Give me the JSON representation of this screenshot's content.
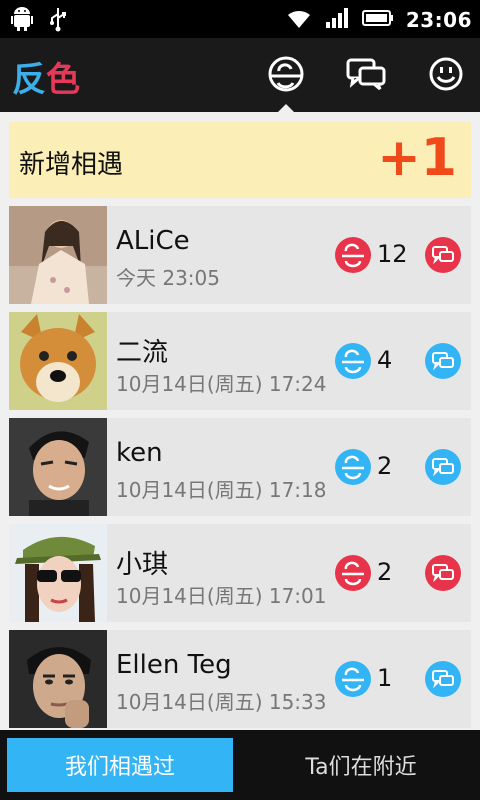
{
  "status_bar": {
    "time": "23:06",
    "icons": [
      "android-debug-icon",
      "usb-icon",
      "wifi-icon",
      "signal-icon",
      "battery-icon"
    ]
  },
  "header": {
    "logo_part1": "反",
    "logo_part2": "色",
    "icons": [
      "meet-icon",
      "chat-icon",
      "smiley-icon"
    ],
    "active_icon": "meet-icon"
  },
  "banner": {
    "text": "新增相遇",
    "count": "+1"
  },
  "contacts": [
    {
      "name": "ALiCe",
      "time": "今天 23:05",
      "meet_count": "12",
      "color": "#e8344a"
    },
    {
      "name": "二流",
      "time": "10月14日(周五) 17:24",
      "meet_count": "4",
      "color": "#33b5f5"
    },
    {
      "name": "ken",
      "time": "10月14日(周五) 17:18",
      "meet_count": "2",
      "color": "#33b5f5"
    },
    {
      "name": "小琪",
      "time": "10月14日(周五) 17:01",
      "meet_count": "2",
      "color": "#e8344a"
    },
    {
      "name": "Ellen Teg",
      "time": "10月14日(周五) 15:33",
      "meet_count": "1",
      "color": "#33b5f5"
    }
  ],
  "tabs": {
    "met": "我们相遇过",
    "nearby": "Ta们在附近"
  },
  "colors": {
    "accent_blue": "#33b5f5",
    "accent_red": "#e8344a",
    "banner_bg": "#fbeeb6",
    "banner_number": "#f04a1a"
  }
}
